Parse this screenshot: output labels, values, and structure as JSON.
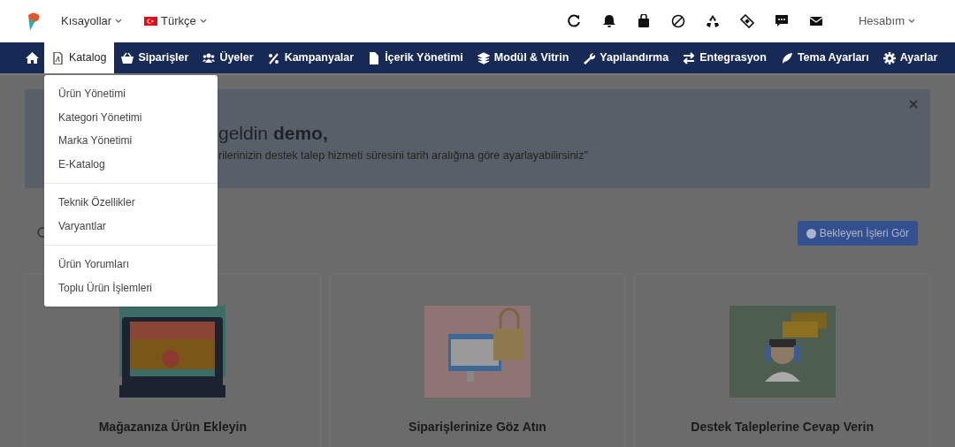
{
  "top_bar": {
    "shortcuts": "Kısayollar",
    "language": "Türkçe",
    "account": "Hesabım"
  },
  "nav": {
    "items": [
      {
        "label": "Katalog",
        "selected": true
      },
      {
        "label": "Siparişler",
        "selected": false
      },
      {
        "label": "Üyeler",
        "selected": false
      },
      {
        "label": "Kampanyalar",
        "selected": false
      },
      {
        "label": "İçerik Yönetimi",
        "selected": false
      },
      {
        "label": "Modül & Vitrin",
        "selected": false
      },
      {
        "label": "Yapılandırma",
        "selected": false
      },
      {
        "label": "Entegrasyon",
        "selected": false
      },
      {
        "label": "Tema Ayarları",
        "selected": false
      },
      {
        "label": "Ayarlar",
        "selected": false
      }
    ]
  },
  "dropdown": {
    "groups": [
      [
        "Ürün Yönetimi",
        "Kategori Yönetimi",
        "Marka Yönetimi",
        "E-Katalog"
      ],
      [
        "Teknik Özellikler",
        "Varyantlar"
      ],
      [
        "Ürün Yorumları",
        "Toplu Ürün İşlemleri"
      ]
    ]
  },
  "alert": {
    "heading": "geldin **demo,**",
    "text": "rilerinizin destek talep hizmeti süresini tarih aralığına göre ayarlayabilirsiniz\""
  },
  "pending_button": "Bekleyen İşleri Gör",
  "cards": [
    {
      "title": "Mağazanıza Ürün Ekleyin"
    },
    {
      "title": "Siparişlerinize Göz Atın"
    },
    {
      "title": "Destek Taleplerine Cevap Verin"
    }
  ]
}
